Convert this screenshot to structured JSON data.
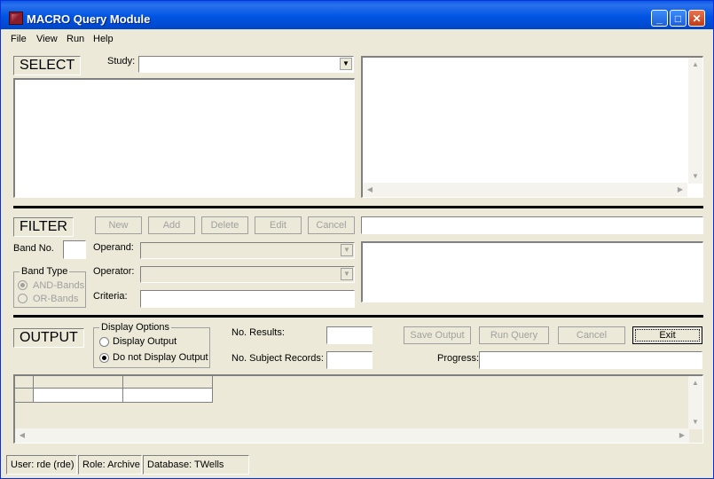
{
  "window": {
    "title": "MACRO Query Module",
    "minimize": "_",
    "maximize": "□",
    "close": "✕"
  },
  "menu": [
    "File",
    "View",
    "Run",
    "Help"
  ],
  "select": {
    "section_label": "SELECT",
    "study_label": "Study:",
    "study_value": ""
  },
  "filter": {
    "section_label": "FILTER",
    "buttons": [
      "New",
      "Add",
      "Delete",
      "Edit",
      "Cancel"
    ],
    "band_no_label": "Band No.",
    "band_no_value": "",
    "operand_label": "Operand:",
    "operator_label": "Operator:",
    "criteria_label": "Criteria:",
    "band_type_title": "Band Type",
    "band_type_options": [
      "AND-Bands",
      "OR-Bands"
    ],
    "band_type_selected": "AND-Bands"
  },
  "output": {
    "section_label": "OUTPUT",
    "display_options_title": "Display Options",
    "display_options": [
      "Display Output",
      "Do not Display Output"
    ],
    "display_selected": "Do not Display Output",
    "no_results_label": "No. Results:",
    "no_subject_records_label": "No. Subject Records:",
    "progress_label": "Progress:",
    "buttons": [
      "Save Output",
      "Run Query",
      "Cancel",
      "Exit"
    ]
  },
  "status": {
    "user": "User: rde (rde)",
    "role": "Role: Archive",
    "database": "Database: TWells"
  },
  "icons": {
    "combo_arrow": "▼",
    "scroll_up": "▲",
    "scroll_down": "▼",
    "scroll_left": "◀",
    "scroll_right": "▶"
  }
}
